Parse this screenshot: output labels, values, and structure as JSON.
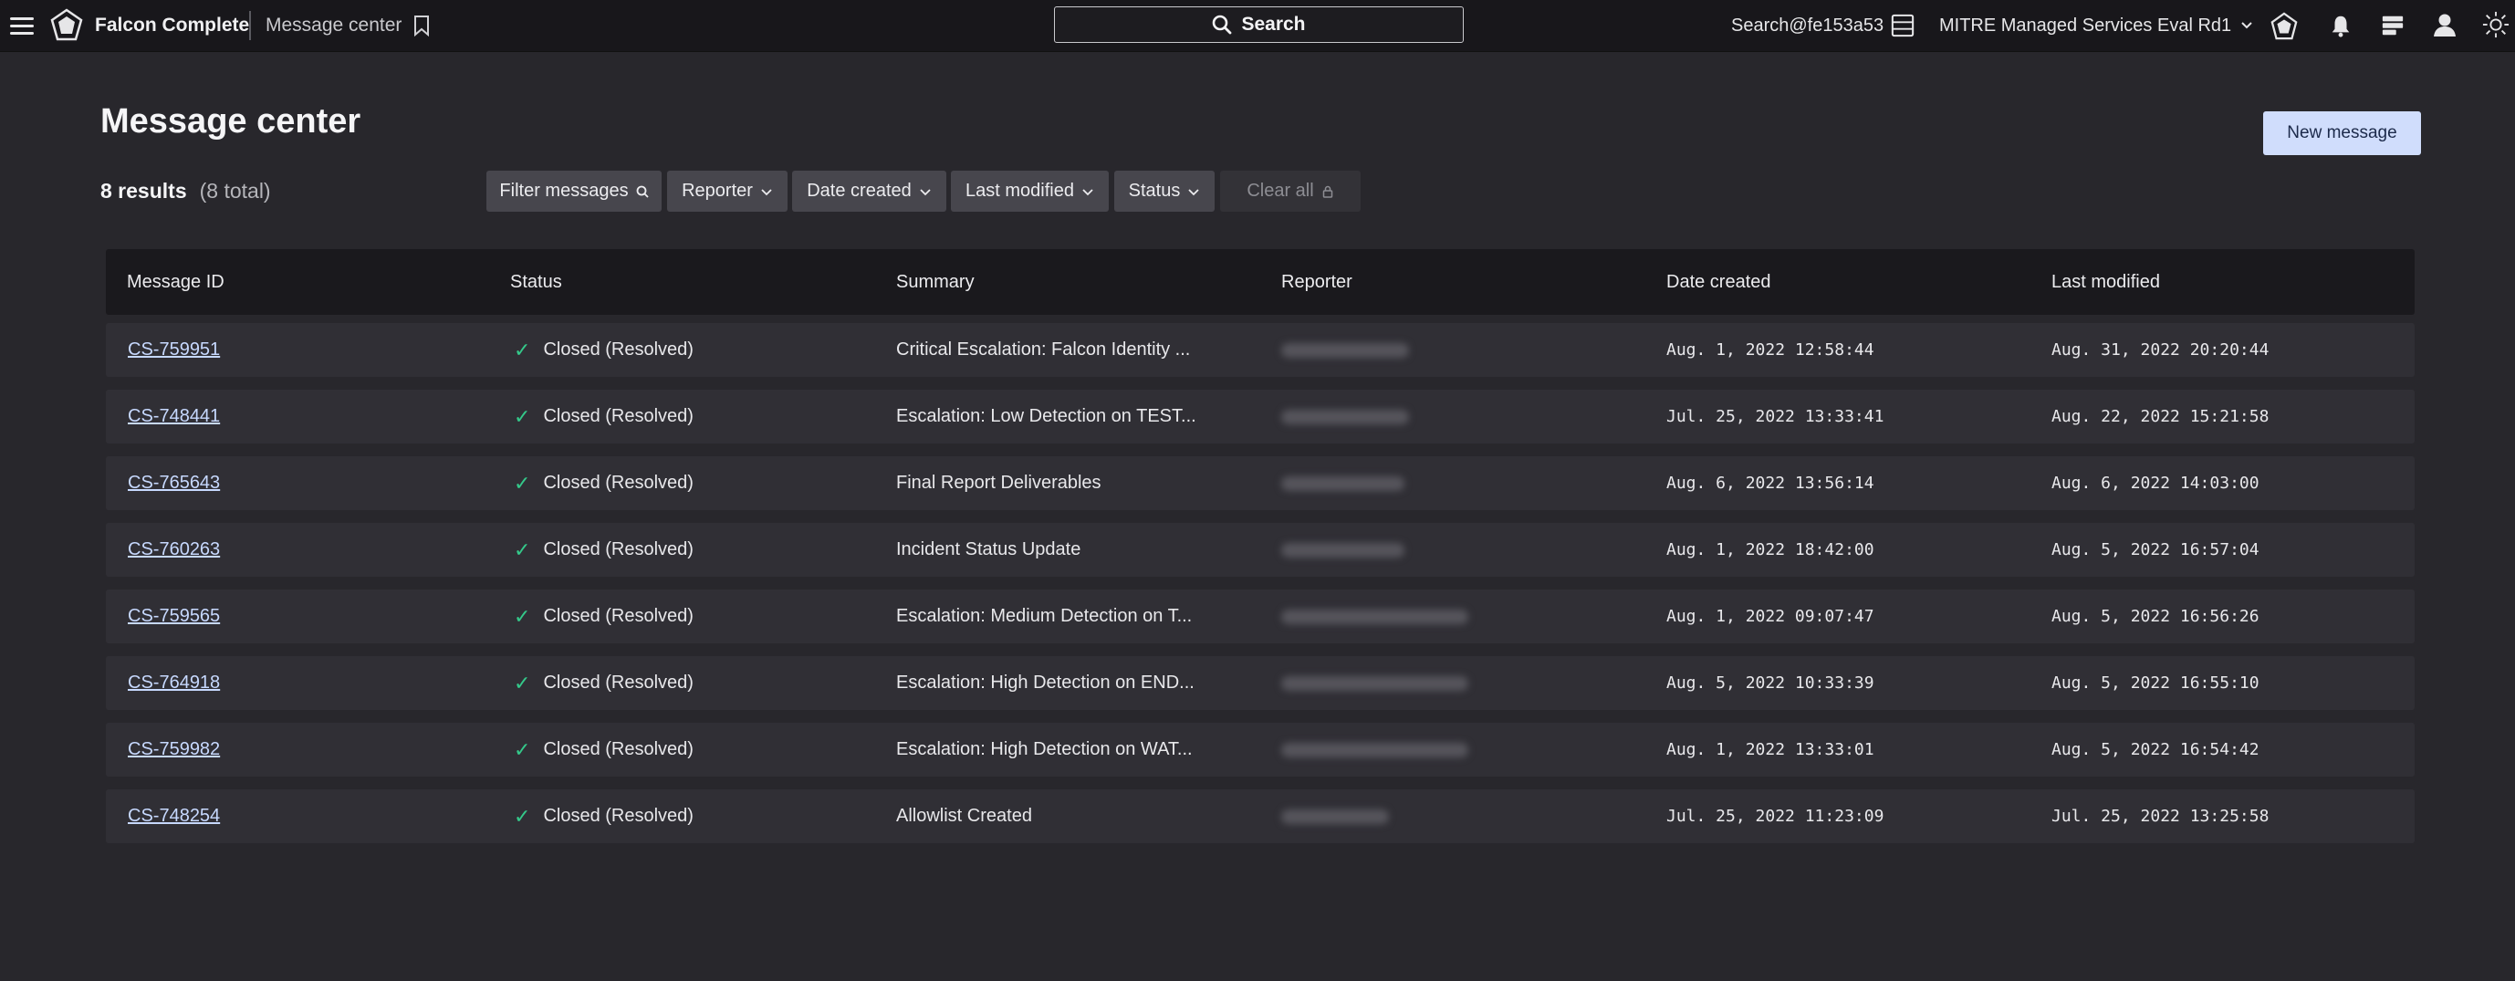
{
  "topbar": {
    "product_name": "Falcon Complete",
    "breadcrumb": "Message center",
    "search_label": "Search",
    "user_search": "Search@fe153a53",
    "cid_name": "MITRE Managed Services Eval Rd1",
    "icons": [
      "menu-icon",
      "falcon-logo-icon",
      "bookmark-icon",
      "search-icon",
      "table-icon",
      "chevron-down-icon",
      "customer-icon",
      "bell-icon",
      "news-icon",
      "user-icon",
      "theme-icon"
    ]
  },
  "page": {
    "title": "Message center",
    "new_message_label": "New message",
    "results_count": "8 results",
    "results_total": "(8 total)"
  },
  "filters": {
    "filter_messages": "Filter messages",
    "reporter": "Reporter",
    "date_created": "Date created",
    "last_modified": "Last modified",
    "status": "Status",
    "clear_all": "Clear all"
  },
  "table": {
    "columns": [
      "Message ID",
      "Status",
      "Summary",
      "Reporter",
      "Date created",
      "Last modified"
    ],
    "rows": [
      {
        "id": "CS-759951",
        "status": "Closed (Resolved)",
        "summary": "Critical Escalation: Falcon Identity ...",
        "reporter": "",
        "date_created": "Aug. 1, 2022 12:58:44",
        "last_modified": "Aug. 31, 2022 20:20:44"
      },
      {
        "id": "CS-748441",
        "status": "Closed (Resolved)",
        "summary": "Escalation: Low Detection on TEST...",
        "reporter": "",
        "date_created": "Jul. 25, 2022 13:33:41",
        "last_modified": "Aug. 22, 2022 15:21:58"
      },
      {
        "id": "CS-765643",
        "status": "Closed (Resolved)",
        "summary": "Final Report Deliverables",
        "reporter": "",
        "date_created": "Aug. 6, 2022 13:56:14",
        "last_modified": "Aug. 6, 2022 14:03:00"
      },
      {
        "id": "CS-760263",
        "status": "Closed (Resolved)",
        "summary": "Incident Status Update",
        "reporter": "",
        "date_created": "Aug. 1, 2022 18:42:00",
        "last_modified": "Aug. 5, 2022 16:57:04"
      },
      {
        "id": "CS-759565",
        "status": "Closed (Resolved)",
        "summary": "Escalation: Medium Detection on T...",
        "reporter": "",
        "date_created": "Aug. 1, 2022 09:07:47",
        "last_modified": "Aug. 5, 2022 16:56:26"
      },
      {
        "id": "CS-764918",
        "status": "Closed (Resolved)",
        "summary": "Escalation: High Detection on END...",
        "reporter": "",
        "date_created": "Aug. 5, 2022 10:33:39",
        "last_modified": "Aug. 5, 2022 16:55:10"
      },
      {
        "id": "CS-759982",
        "status": "Closed (Resolved)",
        "summary": "Escalation: High Detection on WAT...",
        "reporter": "",
        "date_created": "Aug. 1, 2022 13:33:01",
        "last_modified": "Aug. 5, 2022 16:54:42"
      },
      {
        "id": "CS-748254",
        "status": "Closed (Resolved)",
        "summary": "Allowlist Created",
        "reporter": "",
        "date_created": "Jul. 25, 2022 11:23:09",
        "last_modified": "Jul. 25, 2022 13:25:58"
      }
    ]
  },
  "colors": {
    "background": "#28272c",
    "topbar": "#18171b",
    "row": "#302f35",
    "link": "#c7d9ff",
    "success": "#34c98a",
    "primary_button": "#d0ddfc"
  }
}
